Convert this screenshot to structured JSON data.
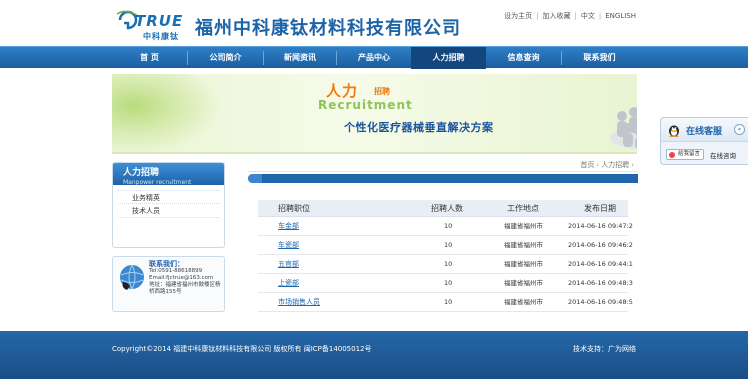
{
  "header": {
    "logo_text": "TRUE",
    "logo_sub": "中科康钛",
    "company_name": "福州中科康钛材料科技有限公司",
    "toplinks": [
      "设为主页",
      "加入收藏",
      "中文",
      "ENGLISH"
    ]
  },
  "nav": {
    "items": [
      "首 页",
      "公司简介",
      "新闻资讯",
      "产品中心",
      "人力招聘",
      "信息查询",
      "联系我们"
    ],
    "active_index": 4
  },
  "banner": {
    "title_cn": "人力",
    "title_small": "招聘",
    "title_en": "Recruitment",
    "slogan": "个性化医疗器械垂直解决方案"
  },
  "sidebar": {
    "head_cn": "人力招聘",
    "head_en": "Manpower recruitment",
    "links": [
      "业务精英",
      "技术人员"
    ]
  },
  "contact": {
    "title": "联系我们：",
    "tel": "Tel:0591-88618899",
    "email": "Email:fjctrue@163.com",
    "address": "地址：福建省福州市鼓楼区杨桥西路155号"
  },
  "breadcrumb": {
    "items": [
      "首页",
      "人力招聘"
    ]
  },
  "table": {
    "columns": [
      "招聘职位",
      "招聘人数",
      "工作地点",
      "发布日期"
    ],
    "rows": [
      {
        "position": "车金部",
        "count": "10",
        "location": "福建省福州市",
        "date": "2014-06-16 09:47:2"
      },
      {
        "position": "车瓷部",
        "count": "10",
        "location": "福建省福州市",
        "date": "2014-06-16 09:46:2"
      },
      {
        "position": "五官部",
        "count": "10",
        "location": "福建省福州市",
        "date": "2014-06-16 09:44:1"
      },
      {
        "position": "上瓷部",
        "count": "10",
        "location": "福建省福州市",
        "date": "2014-06-16 09:48:3"
      },
      {
        "position": "市场销售人员",
        "count": "10",
        "location": "福建省福州市",
        "date": "2014-06-16 09:48:5"
      }
    ]
  },
  "online_service": {
    "title": "在线客服",
    "close": "«",
    "message_button": "给我留言",
    "consult": "在线咨询"
  },
  "footer": {
    "copyright": "Copyright©2014 福建中科康钛材料科技有限公司 版权所有 闽ICP备14005012号",
    "support": "技术支持：广为网络"
  },
  "colors": {
    "brand_blue": "#1e63a8",
    "nav_blue": "#2e7fc7",
    "nav_active": "#12467d",
    "banner_orange": "#f07b10",
    "banner_green": "#8fc35a",
    "footer_blue": "#1a4f87"
  }
}
